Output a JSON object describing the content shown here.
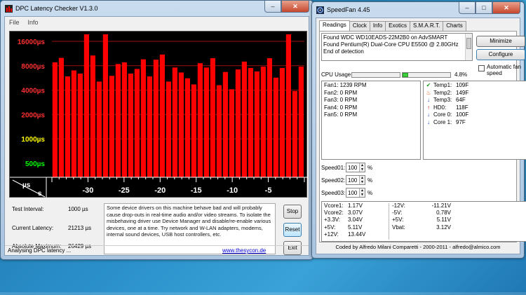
{
  "dpc": {
    "title": "DPC Latency Checker V1.3.0",
    "menu": [
      "File",
      "Info"
    ],
    "chart_data": {
      "type": "bar",
      "xlabel": "s",
      "ylabel": "µs",
      "y_ticks": [
        "16000µs",
        "8000µs",
        "4000µs",
        "2000µs",
        "1000µs",
        "500µs"
      ],
      "x_ticks": [
        "-30",
        "-25",
        "-20",
        "-15",
        "-10",
        "-5"
      ],
      "values": [
        8800,
        10000,
        5900,
        7000,
        6400,
        19800,
        10700,
        5100,
        25700,
        6000,
        8400,
        8800,
        6400,
        7300,
        9600,
        5900,
        9500,
        11000,
        5100,
        7600,
        6600,
        5600,
        4700,
        8600,
        7600,
        9900,
        4600,
        6700,
        4100,
        7200,
        9000,
        7500,
        6800,
        7800,
        9900,
        5700,
        7500,
        23700,
        3900,
        7800
      ],
      "bar_color": "#ff0000"
    },
    "info": {
      "test_interval_label": "Test Interval:",
      "test_interval": "1000 µs",
      "current_latency_label": "Current Latency:",
      "current_latency": "21213 µs",
      "absolute_maximum_label": "Absolute Maximum:",
      "absolute_maximum": "26429 µs"
    },
    "message": "Some device drivers on this machine behave bad and will probably cause drop-outs in real-time audio and/or video streams. To isolate the misbehaving driver use Device Manager and disable/re-enable various devices, one at a time. Try network and W-LAN adapters, modems, internal sound devices, USB host controllers, etc.",
    "buttons": {
      "stop": "Stop",
      "reset": "Reset",
      "exit": "Exit"
    },
    "status": "Analysing DPC latency ...",
    "link": "www.thesycon.de"
  },
  "speedfan": {
    "title": "SpeedFan 4.45",
    "tabs": [
      "Readings",
      "Clock",
      "Info",
      "Exotics",
      "S.M.A.R.T.",
      "Charts"
    ],
    "log": [
      "Found WDC WD10EADS-22M2B0 on AdvSMART",
      "Found Pentium(R) Dual-Core CPU E5500 @ 2.80GHz",
      "End of detection"
    ],
    "buttons": {
      "minimize": "Minimize",
      "configure": "Configure"
    },
    "auto_fan_label": "Automatic fan speed",
    "cpu_usage_label": "CPU Usage",
    "cpu_usage_value": "4.8%",
    "cpu_usage_fraction": 0.048,
    "fans": [
      "Fan1: 1239 RPM",
      "Fan2: 0 RPM",
      "Fan3: 0 RPM",
      "Fan4: 0 RPM",
      "Fan5: 0 RPM"
    ],
    "temps": [
      {
        "icon": "check",
        "label": "Temp1:",
        "value": "109F"
      },
      {
        "icon": "flame",
        "label": "Temp2:",
        "value": "149F"
      },
      {
        "icon": "down",
        "label": "Temp3:",
        "value": "64F"
      },
      {
        "icon": "up",
        "label": "HD0:",
        "value": "118F"
      },
      {
        "icon": "down",
        "label": "Core 0:",
        "value": "100F"
      },
      {
        "icon": "down",
        "label": "Core 1:",
        "value": "97F"
      }
    ],
    "speeds": [
      {
        "label": "Speed01:",
        "value": "100",
        "unit": "%"
      },
      {
        "label": "Speed02:",
        "value": "100",
        "unit": "%"
      },
      {
        "label": "Speed03:",
        "value": "100",
        "unit": "%"
      }
    ],
    "voltages_left": [
      [
        "Vcore1:",
        "1.17V"
      ],
      [
        "Vcore2:",
        "3.07V"
      ],
      [
        "+3.3V:",
        "3.04V"
      ],
      [
        "+5V:",
        "5.11V"
      ],
      [
        "+12V:",
        "13.44V"
      ]
    ],
    "voltages_right": [
      [
        "-12V:",
        "-11.21V"
      ],
      [
        "-5V:",
        "0.78V"
      ],
      [
        "+5V:",
        "5.11V"
      ],
      [
        "Vbat:",
        "3.12V"
      ]
    ],
    "footer": "Coded by Alfredo Milani Comparetti - 2000-2011 - alfredo@almico.com"
  }
}
